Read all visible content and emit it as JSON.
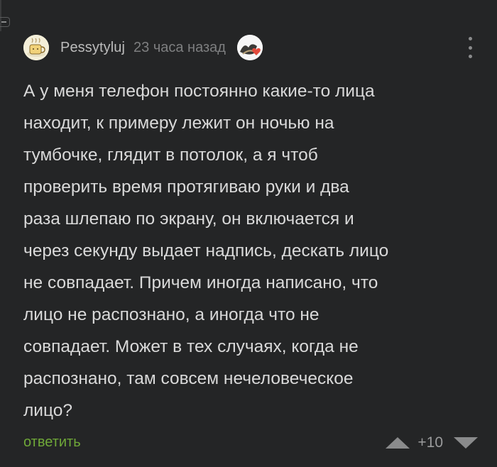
{
  "comment": {
    "author": "Pessytyluj",
    "timestamp": "23 часа назад",
    "avatar_icon": "coffee-cup-avatar",
    "badge_icon": "heart-badge-icon",
    "body_lines": [
      "А у меня телефон постоянно какие-то лица",
      "находит, к примеру лежит он ночью на",
      "тумбочке, глядит в потолок, а я чтоб",
      "проверить время протягиваю руки и два",
      "раза шлепаю по экрану, он включается и",
      "через секунду выдает надпись, дескать лицо",
      "не совпадает. Причем иногда написано, что",
      "лицо не распознано, а иногда что не",
      "совпадает. Может в тех случаях, когда не",
      "распознано, там совсем нечеловеческое",
      "лицо?"
    ],
    "reply_label": "ответить",
    "rating": "+10"
  },
  "colors": {
    "background": "#242526",
    "text": "#d9d9d9",
    "reply": "#6fa838",
    "muted": "#7e7f80",
    "badge_heart": "#e24a3b"
  }
}
